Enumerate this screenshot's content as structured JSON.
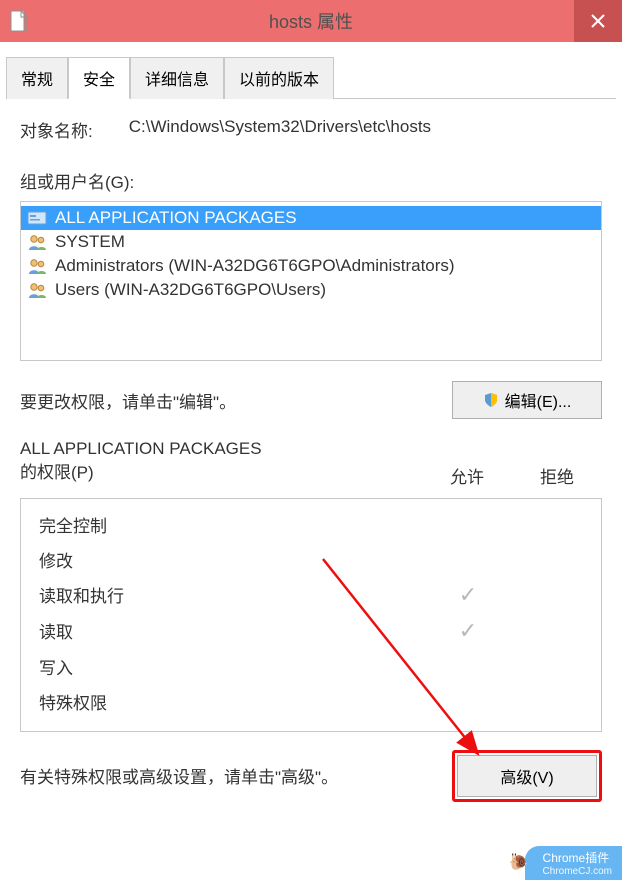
{
  "titlebar": {
    "title": "hosts 属性"
  },
  "tabs": [
    {
      "label": "常规"
    },
    {
      "label": "安全"
    },
    {
      "label": "详细信息"
    },
    {
      "label": "以前的版本"
    }
  ],
  "activeTab": 1,
  "object": {
    "label": "对象名称:",
    "path": "C:\\Windows\\System32\\Drivers\\etc\\hosts"
  },
  "groups": {
    "label": "组或用户名(G):",
    "items": [
      {
        "name": "ALL APPLICATION PACKAGES",
        "iconType": "card",
        "selected": true
      },
      {
        "name": "SYSTEM",
        "iconType": "users",
        "selected": false
      },
      {
        "name": "Administrators (WIN-A32DG6T6GPO\\Administrators)",
        "iconType": "users",
        "selected": false
      },
      {
        "name": "Users (WIN-A32DG6T6GPO\\Users)",
        "iconType": "users",
        "selected": false
      }
    ]
  },
  "edit": {
    "text": "要更改权限，请单击\"编辑\"。",
    "button": "编辑(E)..."
  },
  "permissions": {
    "headingSubject": "ALL APPLICATION PACKAGES",
    "headingSuffix": "的权限(P)",
    "allowLabel": "允许",
    "denyLabel": "拒绝",
    "rows": [
      {
        "name": "完全控制",
        "allow": false,
        "deny": false
      },
      {
        "name": "修改",
        "allow": false,
        "deny": false
      },
      {
        "name": "读取和执行",
        "allow": true,
        "deny": false
      },
      {
        "name": "读取",
        "allow": true,
        "deny": false
      },
      {
        "name": "写入",
        "allow": false,
        "deny": false
      },
      {
        "name": "特殊权限",
        "allow": false,
        "deny": false
      }
    ]
  },
  "advanced": {
    "text": "有关特殊权限或高级设置，请单击\"高级\"。",
    "button": "高级(V)"
  },
  "watermark": {
    "line1": "Chrome插件",
    "line2": "ChromeCJ.com"
  }
}
